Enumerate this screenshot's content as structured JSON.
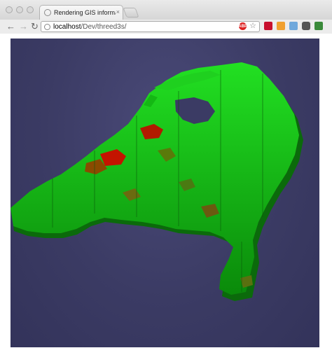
{
  "browser": {
    "tab_title": "Rendering GIS information",
    "tab_close": "×",
    "url_host": "localhost",
    "url_path": "/Dev/threed3s/",
    "adblock_label": "ABP",
    "star_icon": "☆",
    "back_icon": "←",
    "forward_icon": "→",
    "reload_icon": "↻"
  },
  "colors": {
    "background": "#3b3b64",
    "region_high": "#00cc00",
    "region_mid": "#6a7a10",
    "region_low": "#cc1a00"
  },
  "viewport": {
    "scene": "3D extruded map of the Netherlands"
  }
}
